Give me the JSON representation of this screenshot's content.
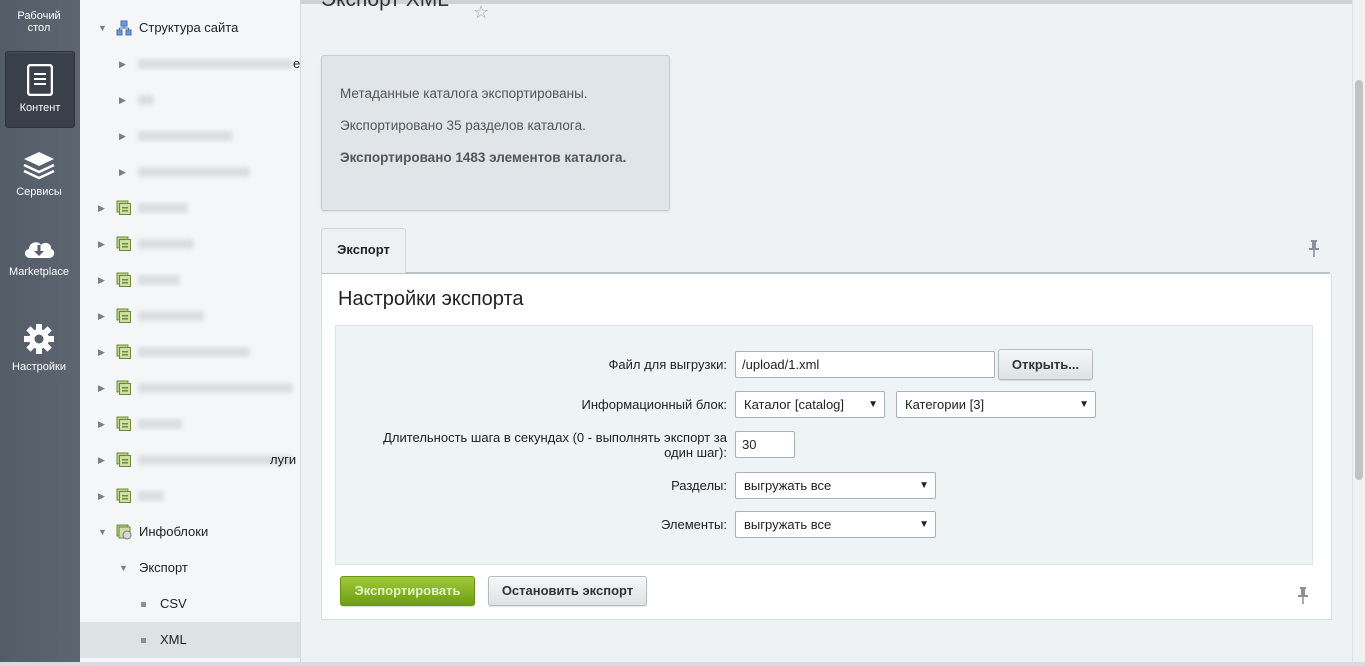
{
  "left_menu": [
    {
      "id": "desktop",
      "label": "Рабочий стол",
      "icon": "desktop-icon"
    },
    {
      "id": "content",
      "label": "Контент",
      "icon": "document-icon",
      "active": true
    },
    {
      "id": "services",
      "label": "Сервисы",
      "icon": "layers-icon"
    },
    {
      "id": "marketplace",
      "label": "Marketplace",
      "icon": "cloud-download-icon"
    },
    {
      "id": "settings",
      "label": "Настройки",
      "icon": "gear-icon"
    }
  ],
  "tree": {
    "site_structure": "Структура сайта",
    "partial_e": "е",
    "partial_uslugi": "луги",
    "infoblocks": "Инфоблоки",
    "export": "Экспорт",
    "csv": "CSV",
    "xml": "XML"
  },
  "page": {
    "title": "Экспорт XML",
    "star_glyph": "☆"
  },
  "messages": {
    "line1": "Метаданные каталога экспортированы.",
    "line2": "Экспортировано 35 разделов каталога.",
    "line3": "Экспортировано 1483 элементов каталога."
  },
  "tabs": {
    "export": "Экспорт"
  },
  "form": {
    "title": "Настройки экспорта",
    "file_label": "Файл для выгрузки:",
    "file_value": "/upload/1.xml",
    "open_button": "Открыть...",
    "iblock_label": "Информационный блок:",
    "iblock_type": "Каталог [catalog]",
    "iblock": "Категории [3]",
    "step_label_1": "Длительность шага в секундах (0 - выполнять экспорт за",
    "step_label_2": "один шаг):",
    "step_value": "30",
    "sections_label": "Разделы:",
    "sections_value": "выгружать все",
    "elements_label": "Элементы:",
    "elements_value": "выгружать все",
    "export_button": "Экспортировать",
    "stop_button": "Остановить экспорт"
  },
  "colors": {
    "left_menu_bg": "#575f6b",
    "green_button": "#8ab52a",
    "panel_bg": "#eef3f4"
  }
}
